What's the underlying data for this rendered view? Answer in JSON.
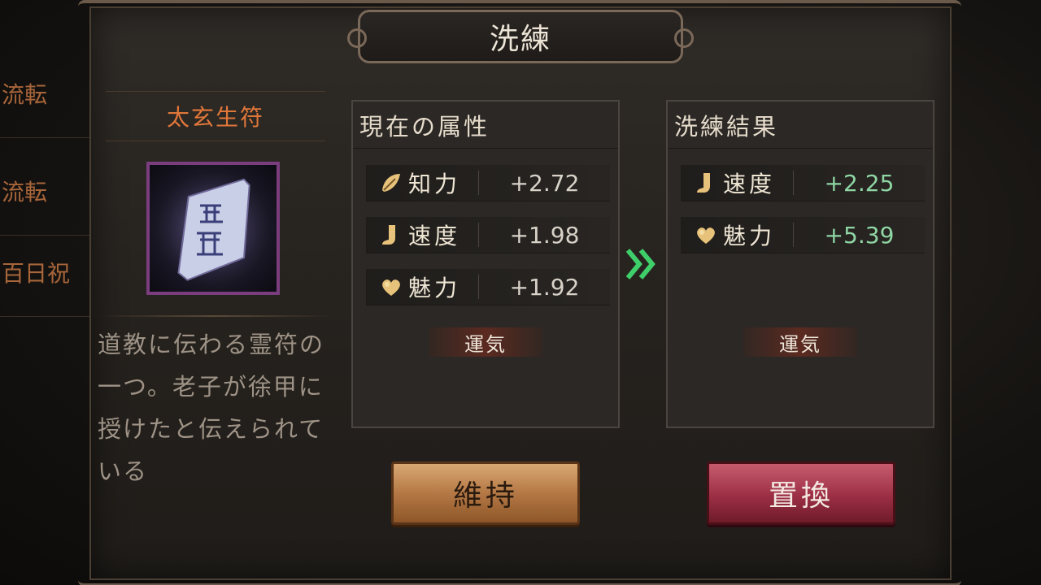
{
  "background": {
    "list_items": [
      "流転",
      "流転",
      "百日祝"
    ]
  },
  "dialog": {
    "title": "洗練"
  },
  "item": {
    "name": "太玄生符",
    "description": "道教に伝わる霊符の一つ。老子が徐甲に授けたと伝えられている",
    "icon": "talisman-scroll-icon",
    "frame_color": "#7a3d7d"
  },
  "current_attributes": {
    "header": "現在の属性",
    "rows": [
      {
        "icon": "wisdom-leaf-icon",
        "name": "知力",
        "value": "+2.72"
      },
      {
        "icon": "speed-boot-icon",
        "name": "速度",
        "value": "+1.98"
      },
      {
        "icon": "charm-heart-icon",
        "name": "魅力",
        "value": "+1.92"
      }
    ],
    "luck_label": "運気"
  },
  "result_attributes": {
    "header": "洗練結果",
    "rows": [
      {
        "icon": "speed-boot-icon",
        "name": "速度",
        "value": "+2.25"
      },
      {
        "icon": "charm-heart-icon",
        "name": "魅力",
        "value": "+5.39"
      }
    ],
    "luck_label": "運気",
    "value_color": "#8fd6a4"
  },
  "arrow": {
    "icon": "double-chevron-right-icon",
    "color": "#3fcf6a"
  },
  "buttons": {
    "keep": "維持",
    "replace": "置換"
  }
}
